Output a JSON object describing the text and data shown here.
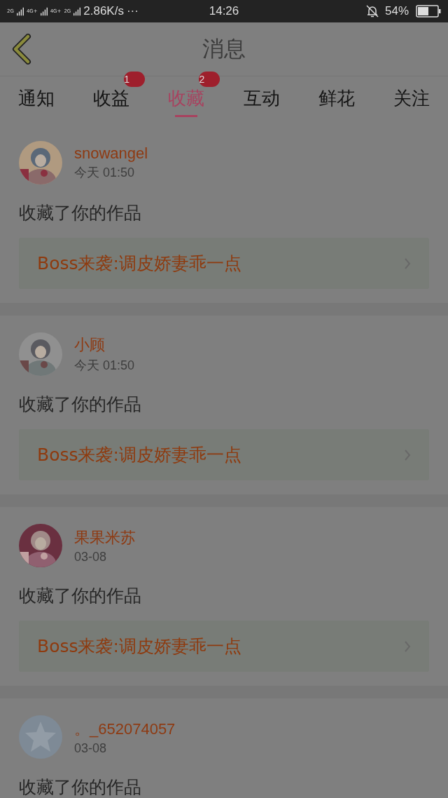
{
  "status_bar": {
    "network": [
      {
        "label": "2G"
      },
      {
        "label": "4G+"
      },
      {
        "label": "4G+",
        "sub": "2G"
      }
    ],
    "speed": "2.86K/s",
    "more": "···",
    "time": "14:26",
    "battery": "54%"
  },
  "header": {
    "title": "消息"
  },
  "tabs": [
    {
      "label": "通知",
      "selected": false
    },
    {
      "label": "收益",
      "selected": false,
      "badge": "1"
    },
    {
      "label": "收藏",
      "selected": true,
      "badge": "2"
    },
    {
      "label": "互动",
      "selected": false
    },
    {
      "label": "鲜花",
      "selected": false
    },
    {
      "label": "关注",
      "selected": false
    }
  ],
  "messages": [
    {
      "user": "snowangel",
      "time": "今天 01:50",
      "text": "收藏了你的作品",
      "work": "Boss来袭:调皮娇妻乖一点"
    },
    {
      "user": "小顾",
      "time": "今天 01:50",
      "text": "收藏了你的作品",
      "work": "Boss来袭:调皮娇妻乖一点"
    },
    {
      "user": "果果米苏",
      "time": "03-08",
      "text": "收藏了你的作品",
      "work": "Boss来袭:调皮娇妻乖一点"
    },
    {
      "avatar": {
        "kind": "default"
      },
      "user": "。_652074057",
      "time": "03-08",
      "text": "收藏了你的作品"
    }
  ]
}
